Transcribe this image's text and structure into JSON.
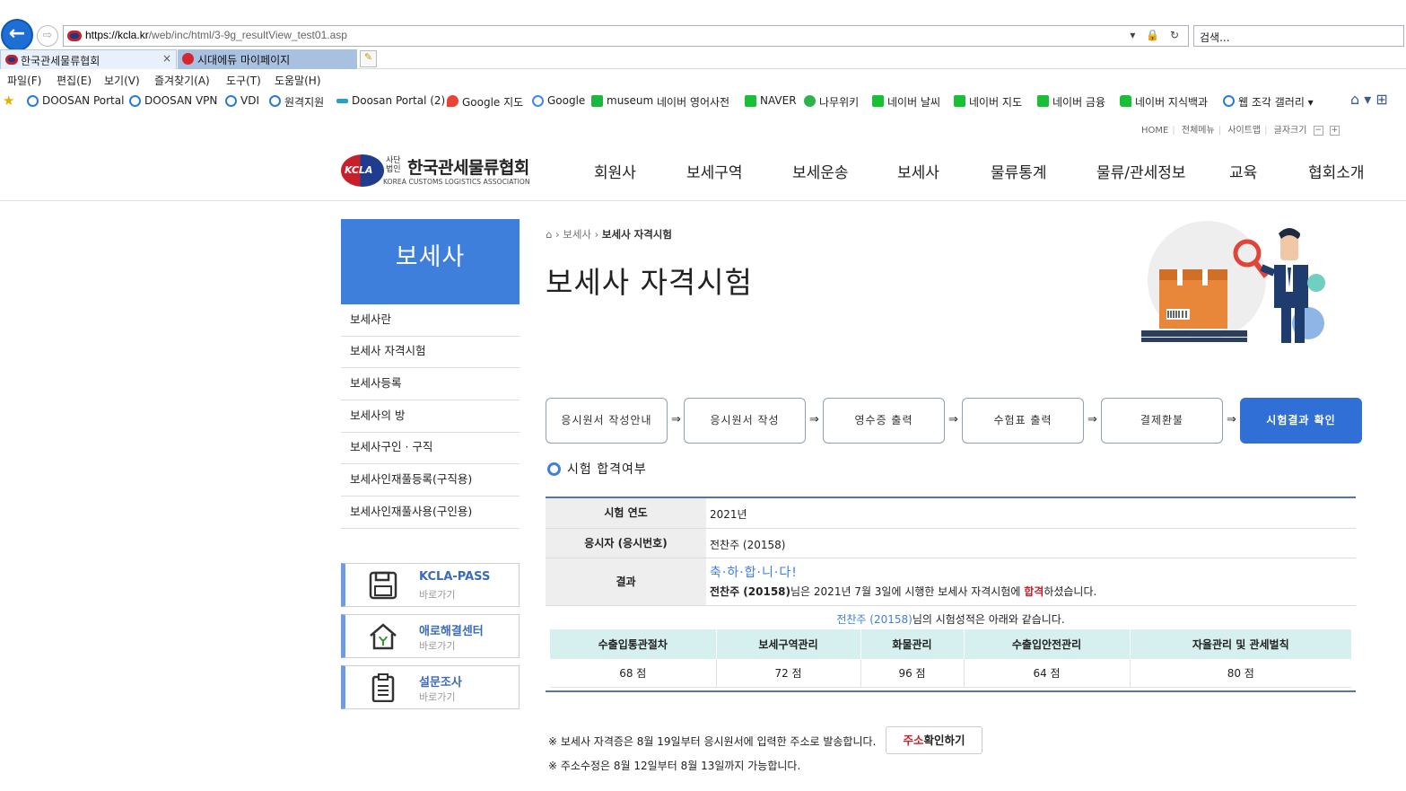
{
  "browser": {
    "url_main": "https://kcla.kr",
    "url_path": "/web/inc/html/3-9g_resultView_test01.asp",
    "search_placeholder": "검색...",
    "tabs": [
      {
        "label": "한국관세물류협회",
        "close": "×"
      },
      {
        "label": "시대에듀 마이페이지"
      }
    ],
    "menus": [
      "파일(F)",
      "편집(E)",
      "보기(V)",
      "즐겨찾기(A)",
      "도구(T)",
      "도움말(H)"
    ],
    "favorites": [
      {
        "label": "DOOSAN Portal",
        "icon": "ie-icon"
      },
      {
        "label": "DOOSAN VPN",
        "icon": "ie-icon"
      },
      {
        "label": "VDI",
        "icon": "ie-icon"
      },
      {
        "label": "원격지원",
        "icon": "ie-icon"
      },
      {
        "label": "Doosan Portal (2)",
        "icon": "portal-icon"
      },
      {
        "label": "Google 지도",
        "icon": "map-pin-icon"
      },
      {
        "label": "Google",
        "icon": "google-icon"
      },
      {
        "label": "museum",
        "icon": "dict-icon"
      },
      {
        "label": "네이버 영어사전",
        "icon": "none"
      },
      {
        "label": "NAVER",
        "icon": "naver-icon"
      },
      {
        "label": "나무위키",
        "icon": "namu-icon"
      },
      {
        "label": "네이버 날씨",
        "icon": "naver-icon"
      },
      {
        "label": "네이버 지도",
        "icon": "naver-icon"
      },
      {
        "label": "네이버 금융",
        "icon": "naver-icon"
      },
      {
        "label": "네이버 지식백과",
        "icon": "knowledge-icon"
      },
      {
        "label": "웹 조각 갤러리 ▾",
        "icon": "ie-icon"
      }
    ]
  },
  "util": {
    "home": "HOME",
    "all_menu": "전체메뉴",
    "sitemap": "사이트맵",
    "font_size": "글자크기",
    "minus": "−",
    "plus": "+"
  },
  "logo": {
    "small": "사단 법인",
    "name": "한국관세물류협회",
    "abbr": "KCLA",
    "english": "KOREA CUSTOMS LOGISTICS ASSOCIATION"
  },
  "gnb": [
    "회원사",
    "보세구역",
    "보세운송",
    "보세사",
    "물류통계",
    "물류/관세정보",
    "교육",
    "협회소개"
  ],
  "sidebar": {
    "title": "보세사",
    "items": [
      "보세사란",
      "보세사 자격시험",
      "보세사등록",
      "보세사의 방",
      "보세사구인 · 구직",
      "보세사인재풀등록(구직용)",
      "보세사인재풀사용(구인용)"
    ],
    "quick": [
      {
        "title": "KCLA-PASS",
        "sub": "바로가기",
        "icon": "save-icon"
      },
      {
        "title": "애로해결센터",
        "sub": "바로가기",
        "icon": "house-icon"
      },
      {
        "title": "설문조사",
        "sub": "바로가기",
        "icon": "clipboard-icon"
      }
    ]
  },
  "breadcrumb": {
    "home": "⌂",
    "level1": "보세사",
    "current": "보세사 자격시험"
  },
  "page_title": "보세사 자격시험",
  "steps": [
    "응시원서 작성안내",
    "응시원서 작성",
    "영수증 출력",
    "수험표 출력",
    "결제환불",
    "시험결과 확인"
  ],
  "section_title": "시험 합격여부",
  "result": {
    "year_label": "시험 연도",
    "year_value": "2021년",
    "applicant_label": "응시자 (응시번호)",
    "applicant_value": "전찬주 (20158)",
    "result_label": "결과",
    "congrats": "축·하·합·니·다!",
    "pass_name": "전찬주 (20158)",
    "pass_mid": "님은 2021년 7월 3일에 시행한 보세사 자격시험에 ",
    "pass_word": "합격",
    "pass_end": "하셨습니다.",
    "summary_name": "전찬주 (20158)",
    "summary_rest": "님의 시험성적은 아래와 같습니다."
  },
  "scores": {
    "headers": [
      "수출입통관절차",
      "보세구역관리",
      "화물관리",
      "수출입안전관리",
      "자율관리 및 관세벌칙"
    ],
    "values": [
      "68 점",
      "72 점",
      "96 점",
      "64 점",
      "80 점"
    ]
  },
  "notes": {
    "line1": "※ 보세사 자격증은 8월 19일부터 응시원서에 입력한 주소로 발송합니다.",
    "btn_red": "주소",
    "btn_rest": "확인하기",
    "line2": "※ 주소수정은 8월 12일부터 8월 13일까지 가능합니다."
  }
}
